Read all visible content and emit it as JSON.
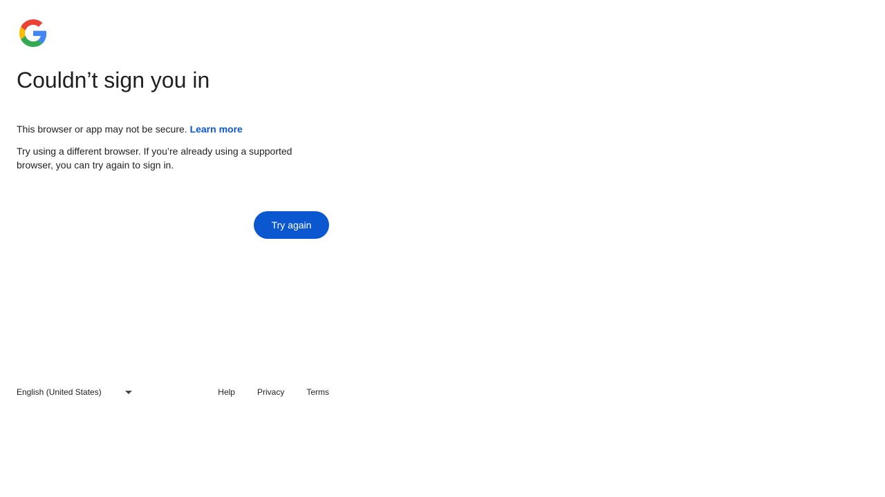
{
  "brand": {
    "logo_icon": "google-g-logo-icon",
    "colors": {
      "blue": "#4285F4",
      "red": "#EA4335",
      "yellow": "#FBBC05",
      "green": "#34A853",
      "accent": "#0b57d0"
    }
  },
  "main": {
    "title": "Couldn’t sign you in",
    "message_primary": "This browser or app may not be secure.",
    "learn_more_label": "Learn more",
    "message_secondary": "Try using a different browser. If you’re already using a supported browser, you can try again to sign in.",
    "try_again_label": "Try again"
  },
  "footer": {
    "language_selected": "English (United States)",
    "language_icon": "caret-down-icon",
    "links": {
      "help": "Help",
      "privacy": "Privacy",
      "terms": "Terms"
    }
  }
}
